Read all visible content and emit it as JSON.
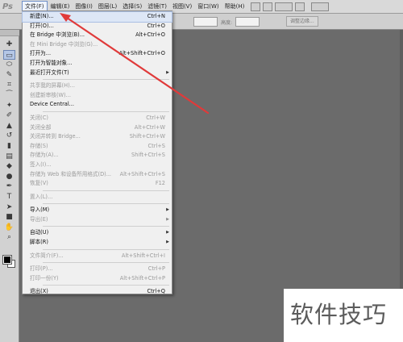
{
  "menubar": {
    "app_logo": "Ps",
    "items": [
      {
        "label": "文件(F)",
        "active": true
      },
      {
        "label": "编辑(E)"
      },
      {
        "label": "图像(I)"
      },
      {
        "label": "图层(L)"
      },
      {
        "label": "选择(S)"
      },
      {
        "label": "滤镜(T)"
      },
      {
        "label": "视图(V)"
      },
      {
        "label": "窗口(W)"
      },
      {
        "label": "帮助(H)"
      }
    ],
    "zoom_icon": "zoom-dropdown-icon",
    "arrange_icon": "arrange-icon"
  },
  "options": {
    "height_label": "高度:",
    "adjust_edge": "调整边缘..."
  },
  "file_menu": [
    {
      "label": "新建(N)...",
      "shortcut": "Ctrl+N",
      "state": "hover"
    },
    {
      "label": "打开(O)...",
      "shortcut": "Ctrl+O"
    },
    {
      "label": "在 Bridge 中浏览(B)...",
      "shortcut": "Alt+Ctrl+O"
    },
    {
      "label": "在 Mini Bridge 中浏览(G)...",
      "shortcut": "",
      "state": "disabled"
    },
    {
      "label": "打开为...",
      "shortcut": "Alt+Shift+Ctrl+O"
    },
    {
      "label": "打开为智能对象...",
      "shortcut": ""
    },
    {
      "label": "最近打开文件(T)",
      "shortcut": "",
      "submenu": true
    },
    {
      "separator": true
    },
    {
      "label": "共享我的屏幕(H)...",
      "shortcut": "",
      "state": "disabled"
    },
    {
      "label": "创建新审核(W)...",
      "shortcut": "",
      "state": "disabled"
    },
    {
      "label": "Device Central...",
      "shortcut": ""
    },
    {
      "separator": true
    },
    {
      "label": "关闭(C)",
      "shortcut": "Ctrl+W",
      "state": "disabled"
    },
    {
      "label": "关闭全部",
      "shortcut": "Alt+Ctrl+W",
      "state": "disabled"
    },
    {
      "label": "关闭并转到 Bridge...",
      "shortcut": "Shift+Ctrl+W",
      "state": "disabled"
    },
    {
      "label": "存储(S)",
      "shortcut": "Ctrl+S",
      "state": "disabled"
    },
    {
      "label": "存储为(A)...",
      "shortcut": "Shift+Ctrl+S",
      "state": "disabled"
    },
    {
      "label": "签入(I)...",
      "shortcut": "",
      "state": "disabled"
    },
    {
      "label": "存储为 Web 和设备所用格式(D)...",
      "shortcut": "Alt+Shift+Ctrl+S",
      "state": "disabled"
    },
    {
      "label": "恢复(V)",
      "shortcut": "F12",
      "state": "disabled"
    },
    {
      "separator": true
    },
    {
      "label": "置入(L)...",
      "shortcut": "",
      "state": "disabled"
    },
    {
      "separator": true
    },
    {
      "label": "导入(M)",
      "shortcut": "",
      "submenu": true
    },
    {
      "label": "导出(E)",
      "shortcut": "",
      "submenu": true,
      "state": "disabled"
    },
    {
      "separator": true
    },
    {
      "label": "自动(U)",
      "shortcut": "",
      "submenu": true
    },
    {
      "label": "脚本(R)",
      "shortcut": "",
      "submenu": true
    },
    {
      "separator": true
    },
    {
      "label": "文件简介(F)...",
      "shortcut": "Alt+Shift+Ctrl+I",
      "state": "disabled"
    },
    {
      "separator": true
    },
    {
      "label": "打印(P)...",
      "shortcut": "Ctrl+P",
      "state": "disabled"
    },
    {
      "label": "打印一份(Y)",
      "shortcut": "Alt+Shift+Ctrl+P",
      "state": "disabled"
    },
    {
      "separator": true
    },
    {
      "label": "退出(X)",
      "shortcut": "Ctrl+Q"
    }
  ],
  "tools": [
    "move-tool-icon",
    "marquee-tool-icon",
    "lasso-tool-icon",
    "quick-select-tool-icon",
    "crop-tool-icon",
    "eyedropper-tool-icon",
    "spot-healing-tool-icon",
    "brush-tool-icon",
    "clone-stamp-tool-icon",
    "history-brush-tool-icon",
    "eraser-tool-icon",
    "gradient-tool-icon",
    "blur-tool-icon",
    "dodge-tool-icon",
    "pen-tool-icon",
    "type-tool-icon",
    "path-select-tool-icon",
    "shape-tool-icon",
    "hand-tool-icon",
    "zoom-tool-icon"
  ],
  "watermark": "软件技巧",
  "colors": {
    "annotation_arrow": "#e03a3a",
    "menu_hover": "#dde7f6",
    "canvas": "#6b6b6b"
  }
}
